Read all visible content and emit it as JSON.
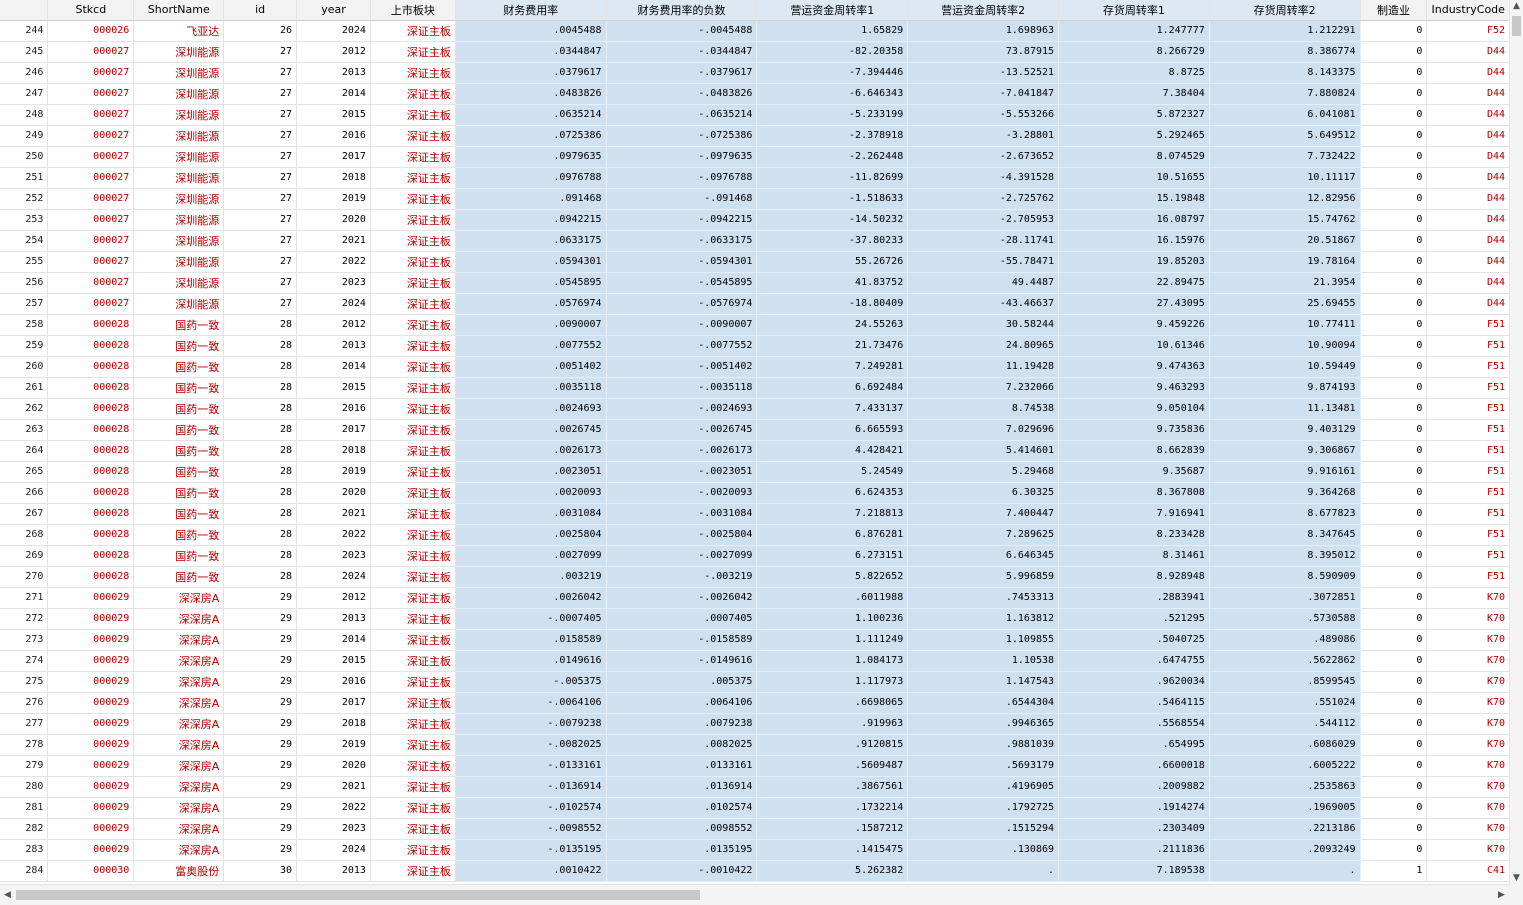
{
  "columns": [
    "",
    "Stkcd",
    "ShortName",
    "id",
    "year",
    "上市板块",
    "财务费用率",
    "财务费用率的负数",
    "营运资金周转率1",
    "营运资金周转率2",
    "存货周转率1",
    "存货周转率2",
    "制造业",
    "IndustryCode"
  ],
  "rows": [
    [
      "244",
      "000026",
      "飞亚达",
      "26",
      "2024",
      "深证主板",
      ".0045488",
      "-.0045488",
      "1.65829",
      "1.698963",
      "1.247777",
      "1.212291",
      "0",
      "F52"
    ],
    [
      "245",
      "000027",
      "深圳能源",
      "27",
      "2012",
      "深证主板",
      ".0344847",
      "-.0344847",
      "-82.20358",
      "73.87915",
      "8.266729",
      "8.386774",
      "0",
      "D44"
    ],
    [
      "246",
      "000027",
      "深圳能源",
      "27",
      "2013",
      "深证主板",
      ".0379617",
      "-.0379617",
      "-7.394446",
      "-13.52521",
      "8.8725",
      "8.143375",
      "0",
      "D44"
    ],
    [
      "247",
      "000027",
      "深圳能源",
      "27",
      "2014",
      "深证主板",
      ".0483826",
      "-.0483826",
      "-6.646343",
      "-7.041847",
      "7.38404",
      "7.880824",
      "0",
      "D44"
    ],
    [
      "248",
      "000027",
      "深圳能源",
      "27",
      "2015",
      "深证主板",
      ".0635214",
      "-.0635214",
      "-5.233199",
      "-5.553266",
      "5.872327",
      "6.041081",
      "0",
      "D44"
    ],
    [
      "249",
      "000027",
      "深圳能源",
      "27",
      "2016",
      "深证主板",
      ".0725386",
      "-.0725386",
      "-2.378918",
      "-3.28801",
      "5.292465",
      "5.649512",
      "0",
      "D44"
    ],
    [
      "250",
      "000027",
      "深圳能源",
      "27",
      "2017",
      "深证主板",
      ".0979635",
      "-.0979635",
      "-2.262448",
      "-2.673652",
      "8.074529",
      "7.732422",
      "0",
      "D44"
    ],
    [
      "251",
      "000027",
      "深圳能源",
      "27",
      "2018",
      "深证主板",
      ".0976788",
      "-.0976788",
      "-11.82699",
      "-4.391528",
      "10.51655",
      "10.11117",
      "0",
      "D44"
    ],
    [
      "252",
      "000027",
      "深圳能源",
      "27",
      "2019",
      "深证主板",
      ".091468",
      "-.091468",
      "-1.518633",
      "-2.725762",
      "15.19848",
      "12.82956",
      "0",
      "D44"
    ],
    [
      "253",
      "000027",
      "深圳能源",
      "27",
      "2020",
      "深证主板",
      ".0942215",
      "-.0942215",
      "-14.50232",
      "-2.705953",
      "16.08797",
      "15.74762",
      "0",
      "D44"
    ],
    [
      "254",
      "000027",
      "深圳能源",
      "27",
      "2021",
      "深证主板",
      ".0633175",
      "-.0633175",
      "-37.80233",
      "-28.11741",
      "16.15976",
      "20.51867",
      "0",
      "D44"
    ],
    [
      "255",
      "000027",
      "深圳能源",
      "27",
      "2022",
      "深证主板",
      ".0594301",
      "-.0594301",
      "55.26726",
      "-55.78471",
      "19.85203",
      "19.78164",
      "0",
      "D44"
    ],
    [
      "256",
      "000027",
      "深圳能源",
      "27",
      "2023",
      "深证主板",
      ".0545895",
      "-.0545895",
      "41.83752",
      "49.4487",
      "22.89475",
      "21.3954",
      "0",
      "D44"
    ],
    [
      "257",
      "000027",
      "深圳能源",
      "27",
      "2024",
      "深证主板",
      ".0576974",
      "-.0576974",
      "-18.80409",
      "-43.46637",
      "27.43095",
      "25.69455",
      "0",
      "D44"
    ],
    [
      "258",
      "000028",
      "国药一致",
      "28",
      "2012",
      "深证主板",
      ".0090007",
      "-.0090007",
      "24.55263",
      "30.58244",
      "9.459226",
      "10.77411",
      "0",
      "F51"
    ],
    [
      "259",
      "000028",
      "国药一致",
      "28",
      "2013",
      "深证主板",
      ".0077552",
      "-.0077552",
      "21.73476",
      "24.80965",
      "10.61346",
      "10.90094",
      "0",
      "F51"
    ],
    [
      "260",
      "000028",
      "国药一致",
      "28",
      "2014",
      "深证主板",
      ".0051402",
      "-.0051402",
      "7.249281",
      "11.19428",
      "9.474363",
      "10.59449",
      "0",
      "F51"
    ],
    [
      "261",
      "000028",
      "国药一致",
      "28",
      "2015",
      "深证主板",
      ".0035118",
      "-.0035118",
      "6.692484",
      "7.232066",
      "9.463293",
      "9.874193",
      "0",
      "F51"
    ],
    [
      "262",
      "000028",
      "国药一致",
      "28",
      "2016",
      "深证主板",
      ".0024693",
      "-.0024693",
      "7.433137",
      "8.74538",
      "9.050104",
      "11.13481",
      "0",
      "F51"
    ],
    [
      "263",
      "000028",
      "国药一致",
      "28",
      "2017",
      "深证主板",
      ".0026745",
      "-.0026745",
      "6.665593",
      "7.029696",
      "9.735836",
      "9.403129",
      "0",
      "F51"
    ],
    [
      "264",
      "000028",
      "国药一致",
      "28",
      "2018",
      "深证主板",
      ".0026173",
      "-.0026173",
      "4.428421",
      "5.414601",
      "8.662839",
      "9.306867",
      "0",
      "F51"
    ],
    [
      "265",
      "000028",
      "国药一致",
      "28",
      "2019",
      "深证主板",
      ".0023051",
      "-.0023051",
      "5.24549",
      "5.29468",
      "9.35687",
      "9.916161",
      "0",
      "F51"
    ],
    [
      "266",
      "000028",
      "国药一致",
      "28",
      "2020",
      "深证主板",
      ".0020093",
      "-.0020093",
      "6.624353",
      "6.30325",
      "8.367808",
      "9.364268",
      "0",
      "F51"
    ],
    [
      "267",
      "000028",
      "国药一致",
      "28",
      "2021",
      "深证主板",
      ".0031084",
      "-.0031084",
      "7.218813",
      "7.400447",
      "7.916941",
      "8.677823",
      "0",
      "F51"
    ],
    [
      "268",
      "000028",
      "国药一致",
      "28",
      "2022",
      "深证主板",
      ".0025804",
      "-.0025804",
      "6.876281",
      "7.289625",
      "8.233428",
      "8.347645",
      "0",
      "F51"
    ],
    [
      "269",
      "000028",
      "国药一致",
      "28",
      "2023",
      "深证主板",
      ".0027099",
      "-.0027099",
      "6.273151",
      "6.646345",
      "8.31461",
      "8.395012",
      "0",
      "F51"
    ],
    [
      "270",
      "000028",
      "国药一致",
      "28",
      "2024",
      "深证主板",
      ".003219",
      "-.003219",
      "5.822652",
      "5.996859",
      "8.928948",
      "8.590909",
      "0",
      "F51"
    ],
    [
      "271",
      "000029",
      "深深房A",
      "29",
      "2012",
      "深证主板",
      ".0026042",
      "-.0026042",
      ".6011988",
      ".7453313",
      ".2883941",
      ".3072851",
      "0",
      "K70"
    ],
    [
      "272",
      "000029",
      "深深房A",
      "29",
      "2013",
      "深证主板",
      "-.0007405",
      ".0007405",
      "1.100236",
      "1.163812",
      ".521295",
      ".5730588",
      "0",
      "K70"
    ],
    [
      "273",
      "000029",
      "深深房A",
      "29",
      "2014",
      "深证主板",
      ".0158589",
      "-.0158589",
      "1.111249",
      "1.109855",
      ".5040725",
      ".489086",
      "0",
      "K70"
    ],
    [
      "274",
      "000029",
      "深深房A",
      "29",
      "2015",
      "深证主板",
      ".0149616",
      "-.0149616",
      "1.084173",
      "1.10538",
      ".6474755",
      ".5622862",
      "0",
      "K70"
    ],
    [
      "275",
      "000029",
      "深深房A",
      "29",
      "2016",
      "深证主板",
      "-.005375",
      ".005375",
      "1.117973",
      "1.147543",
      ".9620034",
      ".8599545",
      "0",
      "K70"
    ],
    [
      "276",
      "000029",
      "深深房A",
      "29",
      "2017",
      "深证主板",
      "-.0064106",
      ".0064106",
      ".6698065",
      ".6544304",
      ".5464115",
      ".551024",
      "0",
      "K70"
    ],
    [
      "277",
      "000029",
      "深深房A",
      "29",
      "2018",
      "深证主板",
      "-.0079238",
      ".0079238",
      ".919963",
      ".9946365",
      ".5568554",
      ".544112",
      "0",
      "K70"
    ],
    [
      "278",
      "000029",
      "深深房A",
      "29",
      "2019",
      "深证主板",
      "-.0082025",
      ".0082025",
      ".9120815",
      ".9881039",
      ".654995",
      ".6086029",
      "0",
      "K70"
    ],
    [
      "279",
      "000029",
      "深深房A",
      "29",
      "2020",
      "深证主板",
      "-.0133161",
      ".0133161",
      ".5609487",
      ".5693179",
      ".6600018",
      ".6005222",
      "0",
      "K70"
    ],
    [
      "280",
      "000029",
      "深深房A",
      "29",
      "2021",
      "深证主板",
      "-.0136914",
      ".0136914",
      ".3867561",
      ".4196905",
      ".2009882",
      ".2535863",
      "0",
      "K70"
    ],
    [
      "281",
      "000029",
      "深深房A",
      "29",
      "2022",
      "深证主板",
      "-.0102574",
      ".0102574",
      ".1732214",
      ".1792725",
      ".1914274",
      ".1969005",
      "0",
      "K70"
    ],
    [
      "282",
      "000029",
      "深深房A",
      "29",
      "2023",
      "深证主板",
      "-.0098552",
      ".0098552",
      ".1587212",
      ".1515294",
      ".2303409",
      ".2213186",
      "0",
      "K70"
    ],
    [
      "283",
      "000029",
      "深深房A",
      "29",
      "2024",
      "深证主板",
      "-.0135195",
      ".0135195",
      ".1415475",
      ".130869",
      ".2111836",
      ".2093249",
      "0",
      "K70"
    ],
    [
      "284",
      "000030",
      "富奥股份",
      "30",
      "2013",
      "深证主板",
      ".0010422",
      "-.0010422",
      "5.262382",
      ".",
      "7.189538",
      ".",
      "1",
      "C41"
    ]
  ],
  "scroll": {
    "up_icon": "▲",
    "down_icon": "▼",
    "left_icon": "◀",
    "right_icon": "▶"
  },
  "colors": {
    "selection": "#cfe0f0",
    "string_text": "#b00000",
    "header_bg": "#f3f3f3"
  }
}
